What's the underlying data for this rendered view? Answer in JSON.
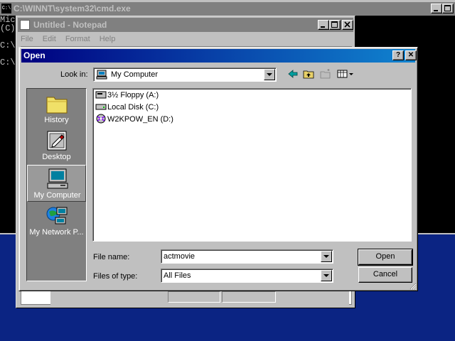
{
  "cmd": {
    "title": "C:\\WINNT\\system32\\cmd.exe",
    "icon_text": "C:\\",
    "lines": [
      "Mic",
      "(C)",
      "",
      "C:\\",
      "",
      "C:\\"
    ]
  },
  "notepad": {
    "title": "Untitled - Notepad",
    "menu": [
      "File",
      "Edit",
      "Format",
      "Help"
    ]
  },
  "dialog": {
    "title": "Open",
    "help_glyph": "?",
    "close_glyph": "✕",
    "look_in_label": "Look in:",
    "look_in_value": "My Computer",
    "places": [
      {
        "label": "History",
        "icon": "history-folder-icon"
      },
      {
        "label": "Desktop",
        "icon": "desktop-icon"
      },
      {
        "label": "My Computer",
        "icon": "my-computer-icon"
      },
      {
        "label": "My Network P...",
        "icon": "network-places-icon"
      }
    ],
    "files": [
      {
        "label": "3½ Floppy (A:)",
        "icon": "floppy-drive-icon"
      },
      {
        "label": "Local Disk (C:)",
        "icon": "hard-drive-icon"
      },
      {
        "label": "W2KPOW_EN (D:)",
        "icon": "cd-drive-icon"
      }
    ],
    "file_name_label": "File name:",
    "file_name_value": "actmovie",
    "files_of_type_label": "Files of type:",
    "files_of_type_value": "All Files",
    "open_label": "Open",
    "cancel_label": "Cancel"
  },
  "colors": {
    "title_active": "#000080",
    "title_inactive": "#808080",
    "face": "#c0c0c0",
    "desktop": "#0b2483"
  }
}
